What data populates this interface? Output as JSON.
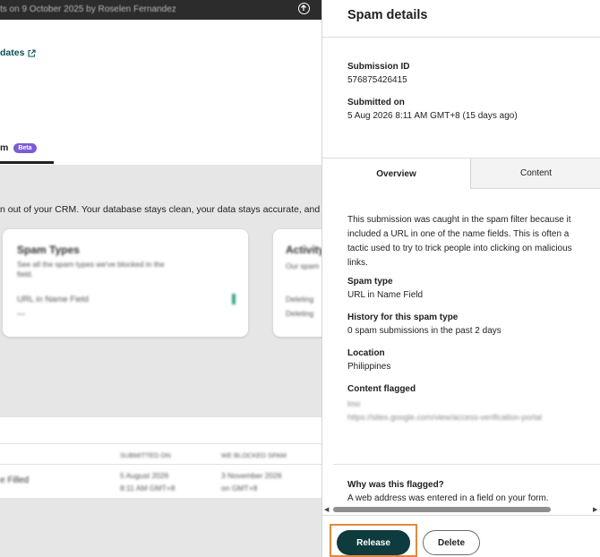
{
  "background": {
    "author_line": "ts on 9 October 2025 by Roselen Fernandez",
    "updates_link": "dates",
    "tab_label": "m",
    "tab_badge": "Beta",
    "description": "n out of your CRM. Your database stays clean, your data stays accurate, and you",
    "card1": {
      "title": "Spam Types",
      "subtitle": "See all the spam types we've blocked in the",
      "subtitle2": "field.",
      "row_label": "URL in Name Field",
      "row_value": "—"
    },
    "card2": {
      "title": "Activity",
      "line1": "Our spam",
      "line2": "Deleting",
      "line3": "Deleting"
    },
    "table": {
      "header_col1": "SUBMITTED ON",
      "header_col2": "WE BLOCKED SPAM",
      "row_name": "e Filled",
      "row_date1": "5 August 2026",
      "row_time1": "8:11 AM GMT+8",
      "row_date2": "3 November 2026",
      "row_time2": "on GMT+8"
    }
  },
  "panel": {
    "title": "Spam details",
    "submission_id_label": "Submission ID",
    "submission_id_value": "576875426415",
    "submitted_on_label": "Submitted on",
    "submitted_on_value": "5 Aug 2026 8:11 AM GMT+8 (15 days ago)",
    "tabs": {
      "overview": "Overview",
      "content": "Content"
    },
    "overview": {
      "description": "This submission was caught in the spam filter because it included a URL in one of the name fields. This is often a tactic used to try to trick people into clicking on malicious links.",
      "spam_type_label": "Spam type",
      "spam_type_value": "URL in Name Field",
      "history_label": "History for this spam type",
      "history_value": "0 spam submissions in the past 2 days",
      "location_label": "Location",
      "location_value": "Philippines",
      "content_flagged_label": "Content flagged",
      "content_flagged_line1": "lmo",
      "content_flagged_line2": "https://sites.google.com/view/access-verification-portal",
      "why_label": "Why was this flagged?",
      "why_value": "A web address was entered in a field on your form."
    },
    "buttons": {
      "release": "Release",
      "delete": "Delete"
    }
  },
  "colors": {
    "primary_button": "#0d3b3e",
    "focus_ring": "#e08a3c",
    "beta_badge": "#7b5cd6",
    "link": "#0d5257"
  }
}
